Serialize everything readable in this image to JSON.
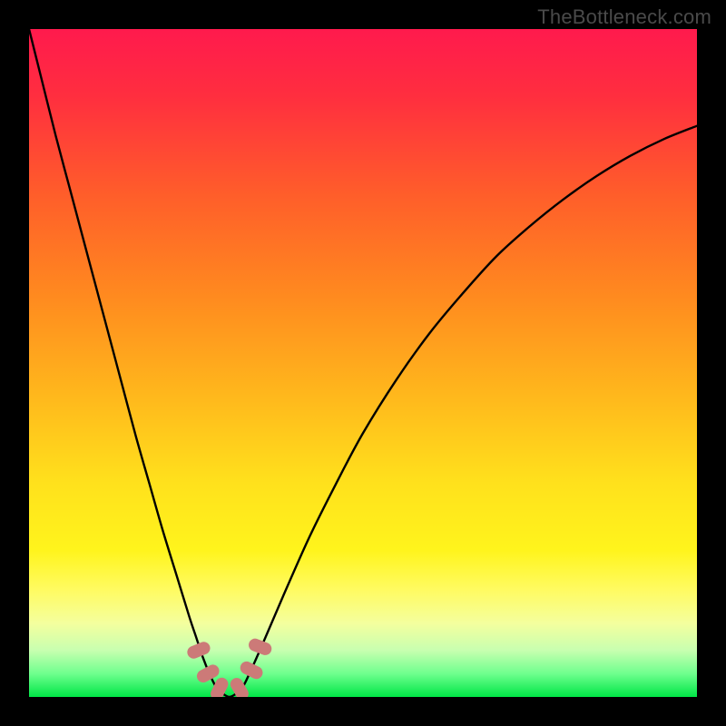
{
  "watermark": "TheBottleneck.com",
  "colors": {
    "frame": "#000000",
    "curve": "#000000",
    "marker_fill": "#cc7a78",
    "green": "#00e646"
  },
  "chart_data": {
    "type": "line",
    "title": "",
    "xlabel": "",
    "ylabel": "",
    "xlim": [
      0,
      100
    ],
    "ylim": [
      0,
      100
    ],
    "gradient_stops": [
      {
        "offset": 0.0,
        "color": "#ff1a4d"
      },
      {
        "offset": 0.1,
        "color": "#ff2e3f"
      },
      {
        "offset": 0.25,
        "color": "#ff5e2a"
      },
      {
        "offset": 0.4,
        "color": "#ff8a1f"
      },
      {
        "offset": 0.55,
        "color": "#ffb81c"
      },
      {
        "offset": 0.68,
        "color": "#ffe11c"
      },
      {
        "offset": 0.78,
        "color": "#fff41c"
      },
      {
        "offset": 0.84,
        "color": "#fffb62"
      },
      {
        "offset": 0.89,
        "color": "#f4ff9e"
      },
      {
        "offset": 0.93,
        "color": "#c8ffb0"
      },
      {
        "offset": 0.965,
        "color": "#6fff8e"
      },
      {
        "offset": 1.0,
        "color": "#00e646"
      }
    ],
    "series": [
      {
        "name": "curve",
        "x": [
          0.0,
          2.0,
          4.0,
          6.0,
          8.0,
          10.0,
          12.0,
          14.0,
          16.0,
          18.0,
          20.0,
          22.0,
          24.0,
          25.0,
          26.0,
          27.0,
          28.0,
          29.0,
          30.0,
          31.0,
          32.0,
          33.0,
          35.0,
          38.0,
          42.0,
          46.0,
          50.0,
          55.0,
          60.0,
          65.0,
          70.0,
          75.0,
          80.0,
          85.0,
          90.0,
          95.0,
          100.0
        ],
        "y": [
          100.0,
          92.0,
          84.0,
          76.5,
          69.0,
          61.5,
          54.0,
          46.5,
          39.0,
          32.0,
          25.0,
          18.5,
          12.0,
          9.0,
          6.0,
          3.5,
          1.5,
          0.5,
          0.0,
          0.5,
          1.5,
          3.5,
          8.0,
          15.0,
          24.0,
          32.0,
          39.5,
          47.5,
          54.5,
          60.5,
          66.0,
          70.5,
          74.5,
          78.0,
          81.0,
          83.5,
          85.5
        ]
      }
    ],
    "markers": {
      "name": "near-bottom-points",
      "shape": "capsule",
      "x": [
        25.4,
        26.8,
        28.5,
        31.5,
        33.3,
        34.6
      ],
      "y": [
        7.0,
        3.5,
        1.2,
        1.2,
        4.0,
        7.5
      ]
    }
  }
}
